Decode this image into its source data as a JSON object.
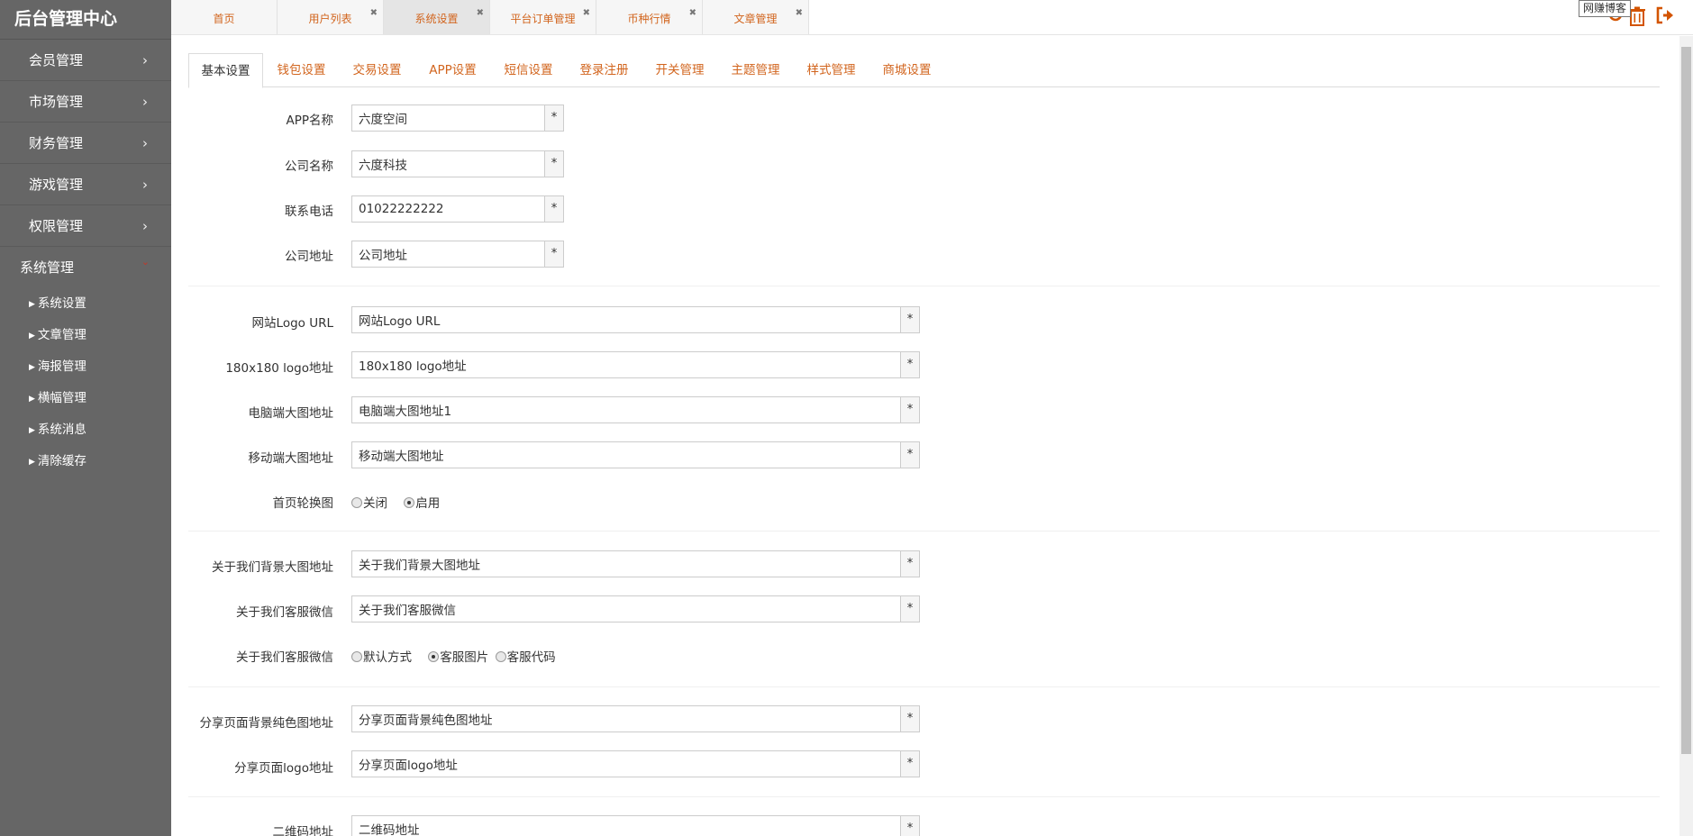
{
  "sidebar": {
    "brand": "后台管理中心",
    "menu": [
      {
        "label": "会员管理",
        "chevron": "›"
      },
      {
        "label": "市场管理",
        "chevron": "›"
      },
      {
        "label": "财务管理",
        "chevron": "›"
      },
      {
        "label": "游戏管理",
        "chevron": "›"
      },
      {
        "label": "权限管理",
        "chevron": "›"
      }
    ],
    "open_menu": {
      "label": "系统管理",
      "chevron": "⌄"
    },
    "sub_items": [
      {
        "label": "系统设置"
      },
      {
        "label": "文章管理"
      },
      {
        "label": "海报管理"
      },
      {
        "label": "横幅管理"
      },
      {
        "label": "系统消息"
      },
      {
        "label": "清除缓存"
      }
    ]
  },
  "top_tabs": [
    {
      "label": "首页",
      "closable": false,
      "active": false
    },
    {
      "label": "用户列表",
      "closable": true,
      "active": false
    },
    {
      "label": "系统设置",
      "closable": true,
      "active": true
    },
    {
      "label": "平台订单管理",
      "closable": true,
      "active": false
    },
    {
      "label": "币种行情",
      "closable": true,
      "active": false
    },
    {
      "label": "文章管理",
      "closable": true,
      "active": false
    }
  ],
  "header": {
    "tooltip": "网赚博客",
    "icons": [
      "refresh-icon",
      "trash-icon",
      "logout-icon"
    ],
    "accent": "#d35400"
  },
  "settings_tabs": [
    {
      "label": "基本设置",
      "active": true
    },
    {
      "label": "钱包设置"
    },
    {
      "label": "交易设置"
    },
    {
      "label": "APP设置"
    },
    {
      "label": "短信设置"
    },
    {
      "label": "登录注册"
    },
    {
      "label": "开关管理"
    },
    {
      "label": "主题管理"
    },
    {
      "label": "样式管理"
    },
    {
      "label": "商城设置"
    }
  ],
  "form": {
    "required_mark": "*",
    "fields": {
      "app_name": {
        "label": "APP名称",
        "value": "六度空间"
      },
      "company_name": {
        "label": "公司名称",
        "value": "六度科技"
      },
      "phone": {
        "label": "联系电话",
        "value": "01022222222"
      },
      "company_address": {
        "label": "公司地址",
        "value": "公司地址"
      },
      "logo_url": {
        "label": "网站Logo URL",
        "value": "网站Logo URL"
      },
      "logo_180": {
        "label": "180x180 logo地址",
        "value": "180x180 logo地址"
      },
      "pc_banner": {
        "label": "电脑端大图地址",
        "value": "电脑端大图地址1"
      },
      "mobile_banner": {
        "label": "移动端大图地址",
        "value": "移动端大图地址"
      },
      "about_bg": {
        "label": "关于我们背景大图地址",
        "value": "关于我们背景大图地址"
      },
      "about_wechat": {
        "label": "关于我们客服微信",
        "value": "关于我们客服微信"
      },
      "share_bg": {
        "label": "分享页面背景纯色图地址",
        "value": "分享页面背景纯色图地址"
      },
      "share_logo": {
        "label": "分享页面logo地址",
        "value": "分享页面logo地址"
      },
      "qrcode": {
        "label": "二维码地址",
        "value": "二维码地址"
      }
    },
    "carousel": {
      "label": "首页轮换图",
      "options": [
        {
          "label": "关闭",
          "checked": false
        },
        {
          "label": "启用",
          "checked": true
        }
      ]
    },
    "service_mode": {
      "label": "关于我们客服微信",
      "options": [
        {
          "label": "默认方式",
          "checked": false
        },
        {
          "label": "客服图片",
          "checked": true
        },
        {
          "label": "客服代码",
          "checked": false
        }
      ]
    }
  }
}
